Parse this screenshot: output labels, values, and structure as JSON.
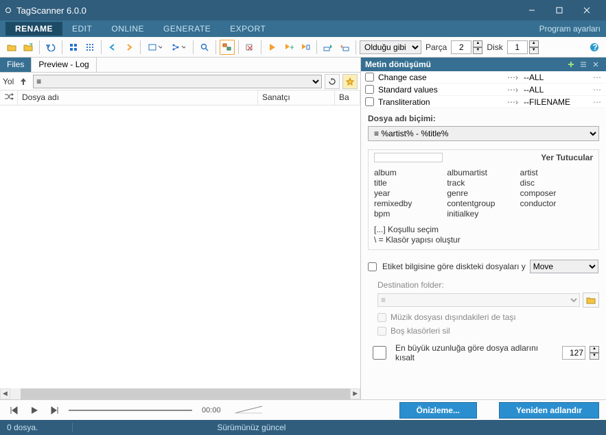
{
  "title": "TagScanner 6.0.0",
  "menu": {
    "items": [
      "RENAME",
      "EDIT",
      "ONLINE",
      "GENERATE",
      "EXPORT"
    ],
    "active": 0,
    "settings": "Program ayarları"
  },
  "toolbar": {
    "view_mode": "Olduğu gibi",
    "parca_label": "Parça",
    "parca_value": "2",
    "disk_label": "Disk",
    "disk_value": "1"
  },
  "tabs": {
    "files": "Files",
    "preview": "Preview - Log"
  },
  "path": {
    "label": "Yol"
  },
  "columns": {
    "shuffle": "",
    "name": "Dosya adı",
    "artist": "Sanatçı",
    "ba": "Ba"
  },
  "transform": {
    "title": "Metin dönüşümü",
    "rows": [
      {
        "name": "Change case",
        "val": "--ALL"
      },
      {
        "name": "Standard values",
        "val": "--ALL"
      },
      {
        "name": "Transliteration",
        "val": "--FILENAME"
      }
    ]
  },
  "pattern": {
    "label": "Dosya adı biçimi:",
    "value": "%artist% - %title%"
  },
  "placeholders": {
    "title": "Yer Tutucular",
    "cols": [
      [
        "album",
        "title",
        "year",
        "remixedby",
        "bpm"
      ],
      [
        "albumartist",
        "track",
        "genre",
        "contentgroup",
        "initialkey"
      ],
      [
        "artist",
        "disc",
        "composer",
        "conductor"
      ]
    ],
    "footer1": "[...] Koşullu seçim",
    "footer2": "\\ = Klasör yapısı oluştur"
  },
  "move": {
    "label": "Etiket bilgisine göre diskteki dosyaları y",
    "select": "Move"
  },
  "dest": {
    "label": "Destination folder:"
  },
  "sub1": "Müzik dosyası dışındakileri de taşı",
  "sub2": "Boş klasörleri sil",
  "trunc": {
    "label": "En büyük uzunluğa göre dosya adlarını kısalt",
    "value": "127"
  },
  "player": {
    "time": "00:00"
  },
  "buttons": {
    "preview": "Önizleme...",
    "rename": "Yeniden adlandır"
  },
  "status": {
    "files": "0 dosya.",
    "version": "Sürümünüz güncel"
  }
}
